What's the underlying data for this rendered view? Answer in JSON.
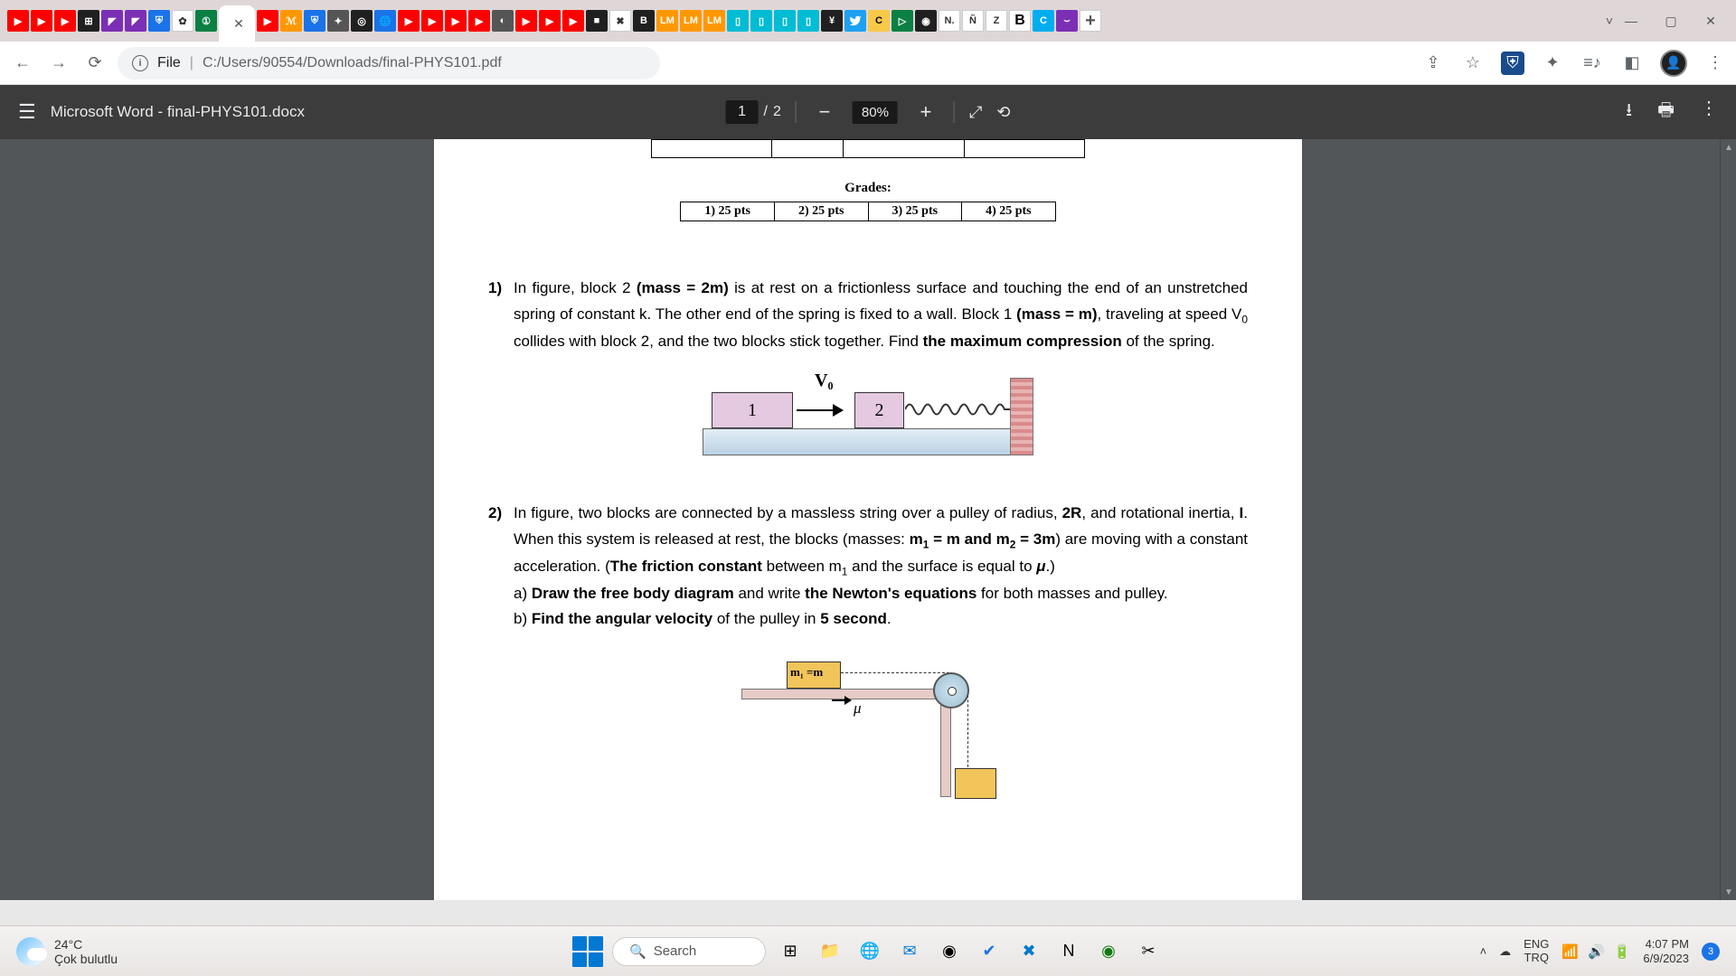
{
  "window": {
    "title_hint": "final-PHYS101.pdf"
  },
  "address_bar": {
    "scheme_label": "File",
    "path": "C:/Users/90554/Downloads/final-PHYS101.pdf"
  },
  "pdf_toolbar": {
    "doc_title": "Microsoft Word - final-PHYS101.docx",
    "page_current": "1",
    "page_total": "2",
    "zoom": "80%"
  },
  "document": {
    "grades_label": "Grades:",
    "grade_cells": [
      "1) 25 pts",
      "2) 25 pts",
      "3) 25 pts",
      "4) 25 pts"
    ],
    "q1": {
      "num": "1)",
      "line1": "In figure, block 2 (mass = 2m) is at rest on a frictionless surface and touching the end of an",
      "line2": "unstretched spring of constant k. The other end of the spring is fixed to a wall. Block 1 (mass",
      "line3": "= m), traveling at speed V₀ collides with block 2, and the two blocks stick together. Find the",
      "line4": "maximum compression of the spring.",
      "fig": {
        "block1": "1",
        "block2": "2",
        "v0": "V₀"
      }
    },
    "q2": {
      "num": "2)",
      "line1": "In figure, two blocks are connected by a massless string over a pulley of radius, 2R, and",
      "line2": "rotational inertia, I. When this system is released at rest, the blocks (masses: m₁ = m and m₂",
      "line3": "= 3m) are moving with a constant acceleration. (The friction constant between m₁ and the",
      "line4": "surface is equal to μ.)",
      "a": "a) Draw the free body diagram and write the Newton's equations for both masses and",
      "a2": "pulley.",
      "b": "b) Find the angular velocity of the pulley in 5 second.",
      "fig": {
        "mass1_label": "m₁ =m",
        "mu": "μ"
      }
    }
  },
  "taskbar": {
    "weather_temp": "24°C",
    "weather_desc": "Çok bulutlu",
    "search_placeholder": "Search",
    "lang_top": "ENG",
    "lang_bottom": "TRQ",
    "time": "4:07 PM",
    "date": "6/9/2023",
    "noti_count": "3"
  }
}
